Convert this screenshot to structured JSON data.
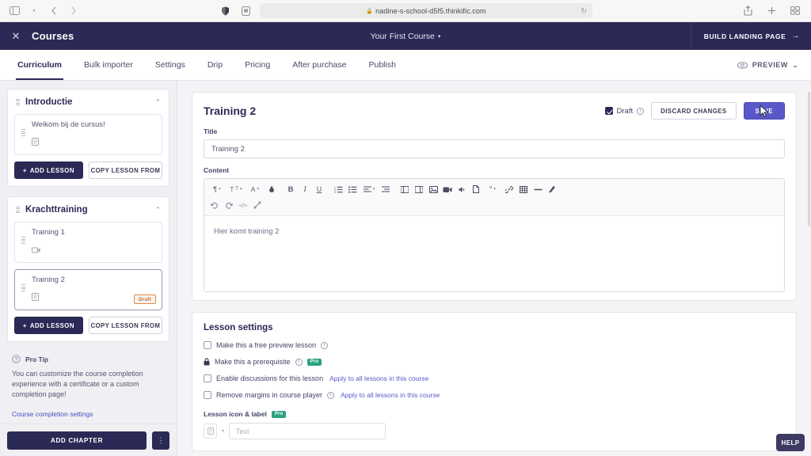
{
  "browser": {
    "url": "nadine-s-school-d5f5.thinkific.com",
    "lock": "🔒",
    "reload_glyph": "↻",
    "sidebar_toggle_icon": "sidebar-toggle-icon",
    "back_icon": "back-arrow-icon",
    "forward_icon": "forward-arrow-icon",
    "share_icon": "share-icon",
    "new_tab_icon": "plus-icon",
    "tabs_overview_icon": "tab-overview-icon",
    "shield_icon": "privacy-shield-icon",
    "extension_icon": "extension-icon"
  },
  "topbar": {
    "close_glyph": "✕",
    "section_label": "Courses",
    "course_name": "Your First Course",
    "caret": "▾",
    "build_landing_page": "BUILD LANDING PAGE",
    "arrow": "→"
  },
  "tabs": {
    "items": [
      {
        "label": "Curriculum",
        "active": true
      },
      {
        "label": "Bulk importer",
        "active": false
      },
      {
        "label": "Settings",
        "active": false
      },
      {
        "label": "Drip",
        "active": false
      },
      {
        "label": "Pricing",
        "active": false
      },
      {
        "label": "After purchase",
        "active": false
      },
      {
        "label": "Publish",
        "active": false
      }
    ],
    "preview_label": "PREVIEW",
    "preview_caret": "⌄"
  },
  "sidebar": {
    "chapters": [
      {
        "title": "Introductie",
        "collapse_caret": "⌃",
        "lessons": [
          {
            "name": "Welkom bij de cursus!",
            "type_icon": "text-lesson-icon",
            "draft": false,
            "selected": false
          }
        ],
        "add_lesson_label": "ADD LESSON",
        "add_lesson_plus": "+",
        "copy_lesson_label": "COPY LESSON FROM"
      },
      {
        "title": "Krachttraining",
        "collapse_caret": "⌃",
        "lessons": [
          {
            "name": "Training 1",
            "type_icon": "video-lesson-icon",
            "draft": false,
            "selected": false
          },
          {
            "name": "Training 2",
            "type_icon": "text-lesson-icon",
            "draft": true,
            "draft_label": "Draft",
            "selected": true
          }
        ],
        "add_lesson_label": "ADD LESSON",
        "add_lesson_plus": "+",
        "copy_lesson_label": "COPY LESSON FROM"
      }
    ],
    "pro_tip": {
      "title": "Pro Tip",
      "body": "You can customize the course completion experience with a certificate or a custom completion page!",
      "link": "Course completion settings"
    },
    "footer": {
      "add_chapter_label": "ADD CHAPTER",
      "more_glyph": "⋮"
    }
  },
  "lesson": {
    "heading": "Training 2",
    "draft_checkbox_label": "Draft",
    "draft_checked": true,
    "info_glyph": "i",
    "discard_label": "DISCARD CHANGES",
    "save_label": "SAVE",
    "title_field_label": "Title",
    "title_value": "Training 2",
    "content_field_label": "Content",
    "editor_text": "Hier komt training 2",
    "toolbar_row1": [
      {
        "name": "paragraph-format-icon",
        "glyph": "¶",
        "caret": true
      },
      {
        "name": "text-style-icon",
        "glyph": "Tt",
        "caret": true
      },
      {
        "name": "font-color-icon",
        "glyph": "A",
        "caret": true
      },
      {
        "name": "highlight-color-icon",
        "glyph": "▲",
        "caret": false
      },
      {
        "name": "bold-icon",
        "glyph": "B",
        "caret": false
      },
      {
        "name": "italic-icon",
        "glyph": "I",
        "caret": false
      },
      {
        "name": "underline-icon",
        "glyph": "U",
        "caret": false
      },
      {
        "name": "ordered-list-icon",
        "glyph": "≔",
        "caret": false
      },
      {
        "name": "unordered-list-icon",
        "glyph": "≡",
        "caret": false
      },
      {
        "name": "align-icon",
        "glyph": "≣",
        "caret": true
      },
      {
        "name": "indent-icon",
        "glyph": "▤",
        "caret": false
      },
      {
        "name": "outdent-icon",
        "glyph": "▥",
        "caret": false
      },
      {
        "name": "line-height-icon",
        "glyph": "▦",
        "caret": false
      },
      {
        "name": "insert-image-icon",
        "glyph": "▣",
        "caret": false
      },
      {
        "name": "insert-video-icon",
        "glyph": "▶",
        "caret": false
      },
      {
        "name": "insert-audio-icon",
        "glyph": "◀",
        "caret": false
      },
      {
        "name": "insert-file-icon",
        "glyph": "🗋",
        "caret": false
      },
      {
        "name": "quote-icon",
        "glyph": "❝",
        "caret": true
      },
      {
        "name": "insert-link-icon",
        "glyph": "🔗",
        "caret": false
      },
      {
        "name": "insert-table-icon",
        "glyph": "▦",
        "caret": false
      },
      {
        "name": "horizontal-rule-icon",
        "glyph": "—",
        "caret": false
      },
      {
        "name": "clear-formatting-icon",
        "glyph": "✒",
        "caret": false
      }
    ],
    "toolbar_row2": [
      {
        "name": "undo-icon",
        "glyph": "↺"
      },
      {
        "name": "redo-icon",
        "glyph": "↻"
      },
      {
        "name": "code-view-icon",
        "glyph": "</>"
      },
      {
        "name": "fullscreen-icon",
        "glyph": "⤢"
      }
    ]
  },
  "settings": {
    "heading": "Lesson settings",
    "rows": [
      {
        "name": "free-preview",
        "checkbox": true,
        "checked": false,
        "label": "Make this a free preview lesson",
        "info": true,
        "pro": false,
        "apply_link": ""
      },
      {
        "name": "prerequisite",
        "checkbox": false,
        "lock": true,
        "label": "Make this a prerequisite",
        "info": true,
        "pro": true,
        "pro_label": "Pro",
        "apply_link": ""
      },
      {
        "name": "enable-discussions",
        "checkbox": true,
        "checked": false,
        "label": "Enable discussions for this lesson",
        "info": false,
        "pro": false,
        "apply_link": "Apply to all lessons in this course"
      },
      {
        "name": "remove-margins",
        "checkbox": true,
        "checked": false,
        "label": "Remove margins in course player",
        "info": true,
        "pro": false,
        "apply_link": "Apply to all lessons in this course"
      }
    ],
    "icon_label": {
      "title": "Lesson icon & label",
      "pro_label": "Pro",
      "icon_name": "lesson-icon-preview",
      "caret": "▾",
      "text_placeholder": "Text",
      "text_value": ""
    }
  },
  "help": {
    "label": "HELP"
  },
  "colors": {
    "brand_navy": "#2b2955",
    "save_purple": "#5a58c8",
    "draft_orange": "#d9722a",
    "pro_green": "#2aa37f",
    "link_blue": "#5a58c8"
  }
}
